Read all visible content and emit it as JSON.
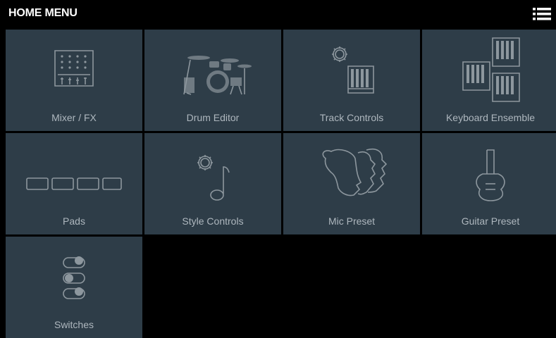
{
  "header": {
    "title": "HOME MENU",
    "menu_icon": "hamburger-list-icon"
  },
  "colors": {
    "tile_bg": "#2e3d48",
    "icon_stroke": "#8d979e",
    "label": "#aeb7be",
    "background": "#000000"
  },
  "tiles": [
    {
      "label": "Mixer / FX",
      "icon": "mixer-icon"
    },
    {
      "label": "Drum Editor",
      "icon": "drum-kit-icon"
    },
    {
      "label": "Track Controls",
      "icon": "gear-keyboard-icon"
    },
    {
      "label": "Keyboard Ensemble",
      "icon": "keyboards-icon"
    },
    {
      "label": "Pads",
      "icon": "pads-icon"
    },
    {
      "label": "Style Controls",
      "icon": "gear-note-icon"
    },
    {
      "label": "Mic Preset",
      "icon": "faces-icon"
    },
    {
      "label": "Guitar Preset",
      "icon": "guitar-icon"
    },
    {
      "label": "Switches",
      "icon": "switches-icon"
    }
  ]
}
